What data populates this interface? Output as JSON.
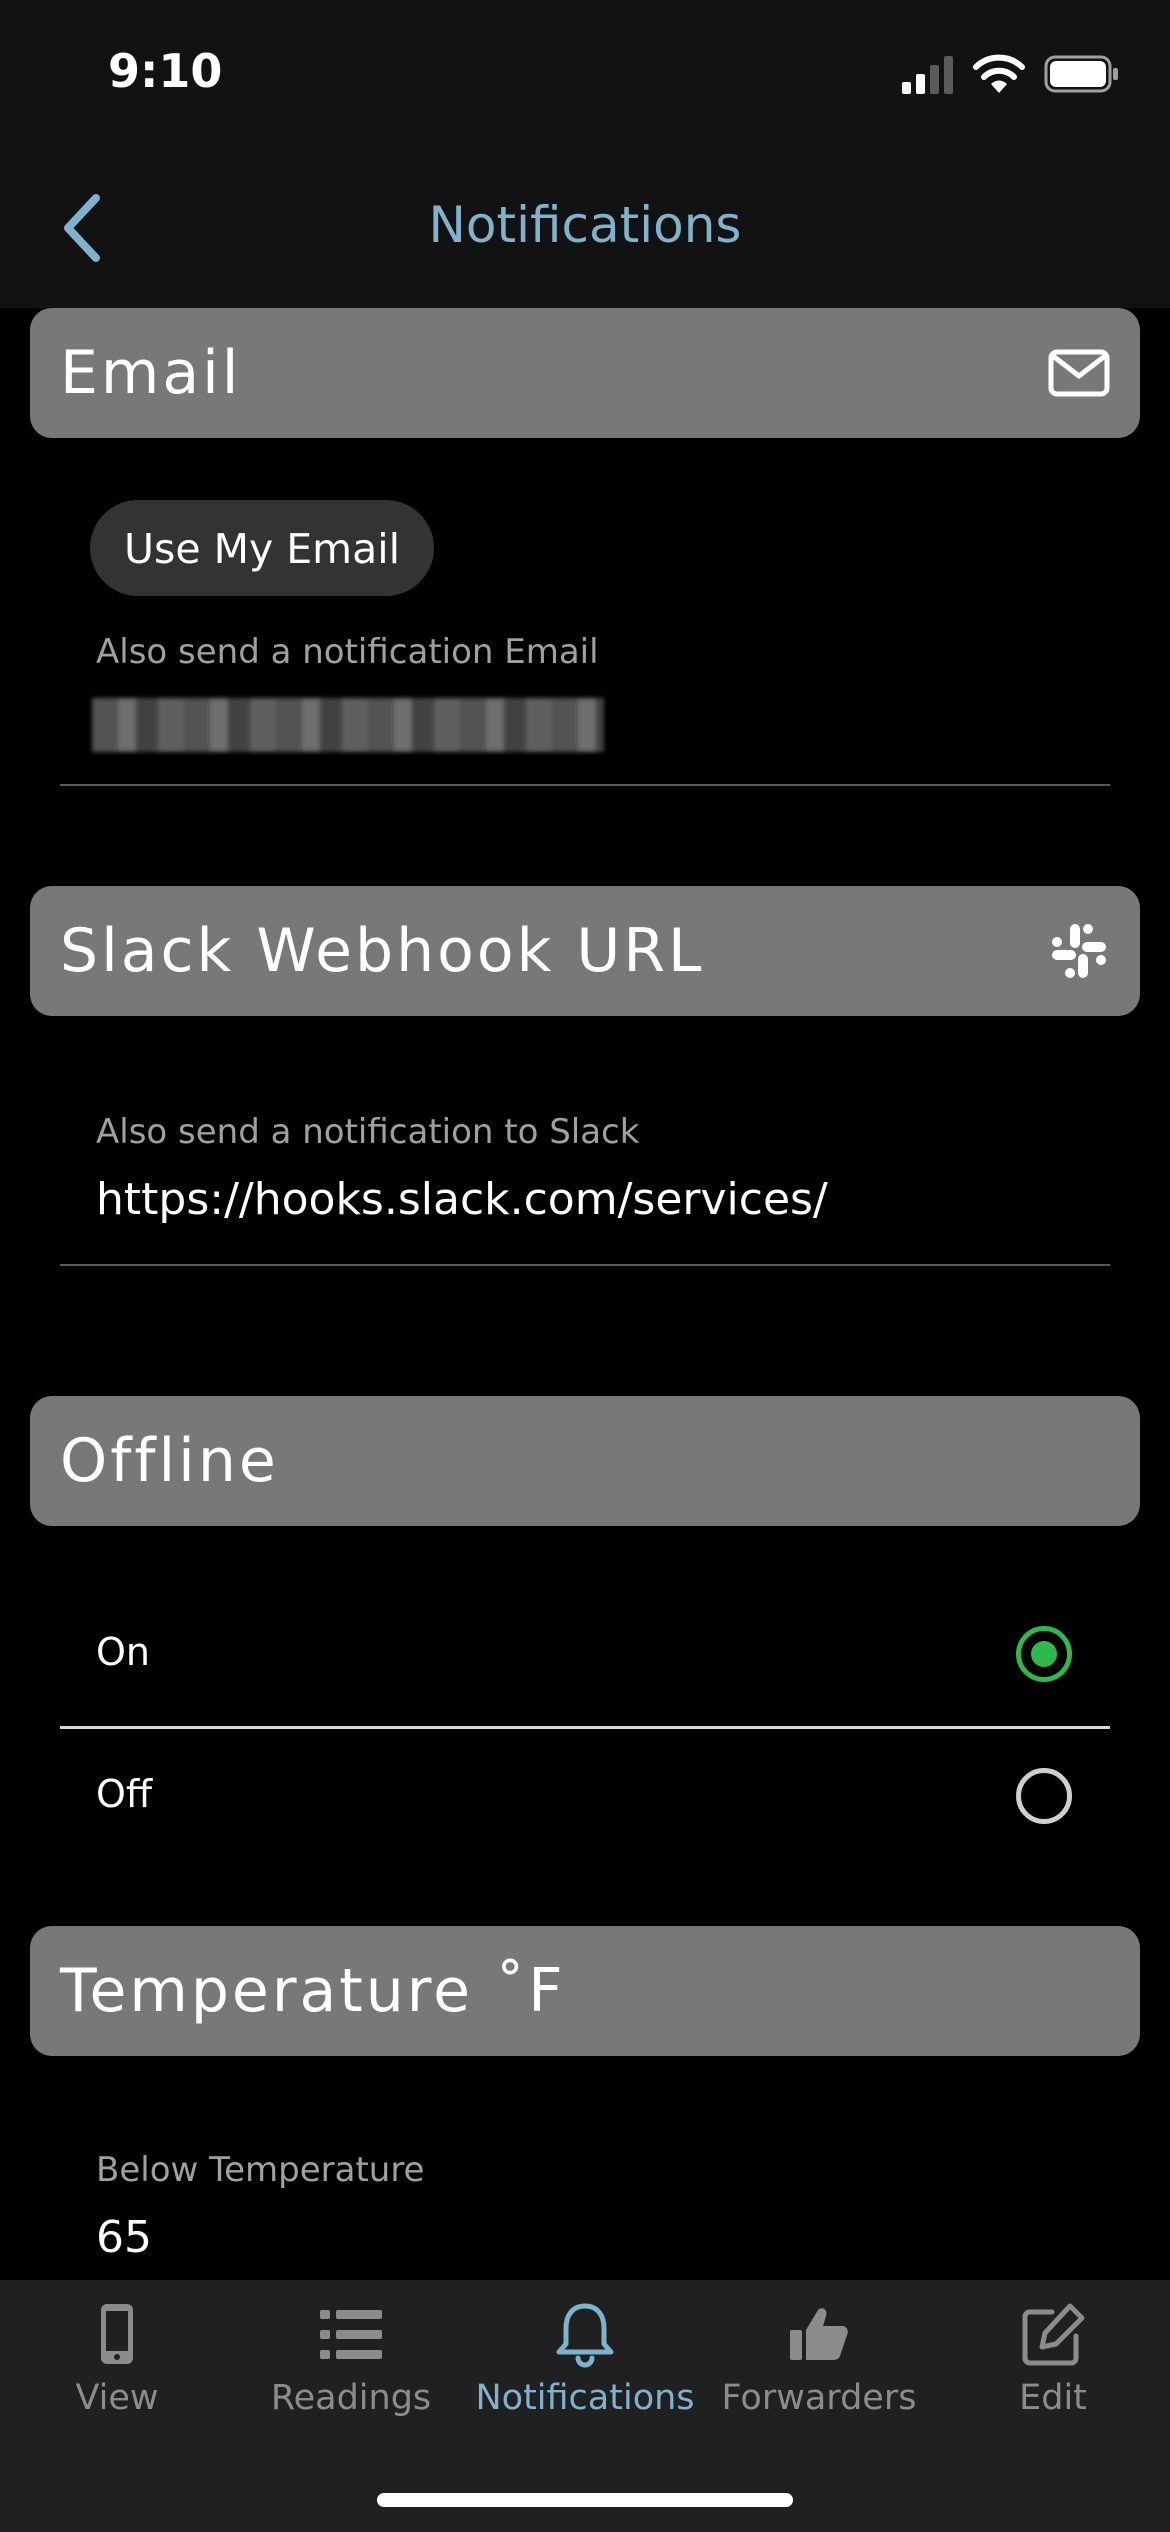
{
  "status_bar": {
    "time": "9:10"
  },
  "nav": {
    "title": "Notifications"
  },
  "sections": {
    "email": {
      "title": "Email",
      "use_my_email_label": "Use My Email",
      "field_label": "Also send a notification Email"
    },
    "slack": {
      "title": "Slack Webhook URL",
      "field_label": "Also send a notification to Slack",
      "field_value": "https://hooks.slack.com/services/"
    },
    "offline": {
      "title": "Offline",
      "options": [
        {
          "label": "On",
          "selected": true
        },
        {
          "label": "Off",
          "selected": false
        }
      ]
    },
    "temperature": {
      "title": "Temperature ˚F",
      "field_label": "Below Temperature",
      "field_value": "65"
    }
  },
  "tabs": [
    {
      "label": "View",
      "icon": "phone-icon",
      "active": false
    },
    {
      "label": "Readings",
      "icon": "list-icon",
      "active": false
    },
    {
      "label": "Notifications",
      "icon": "bell-icon",
      "active": true
    },
    {
      "label": "Forwarders",
      "icon": "thumbs-up-icon",
      "active": false
    },
    {
      "label": "Edit",
      "icon": "edit-icon",
      "active": false
    }
  ],
  "colors": {
    "accent": "#7fb2cc",
    "selected_radio": "#2fb84c",
    "section_header": "#787878"
  }
}
